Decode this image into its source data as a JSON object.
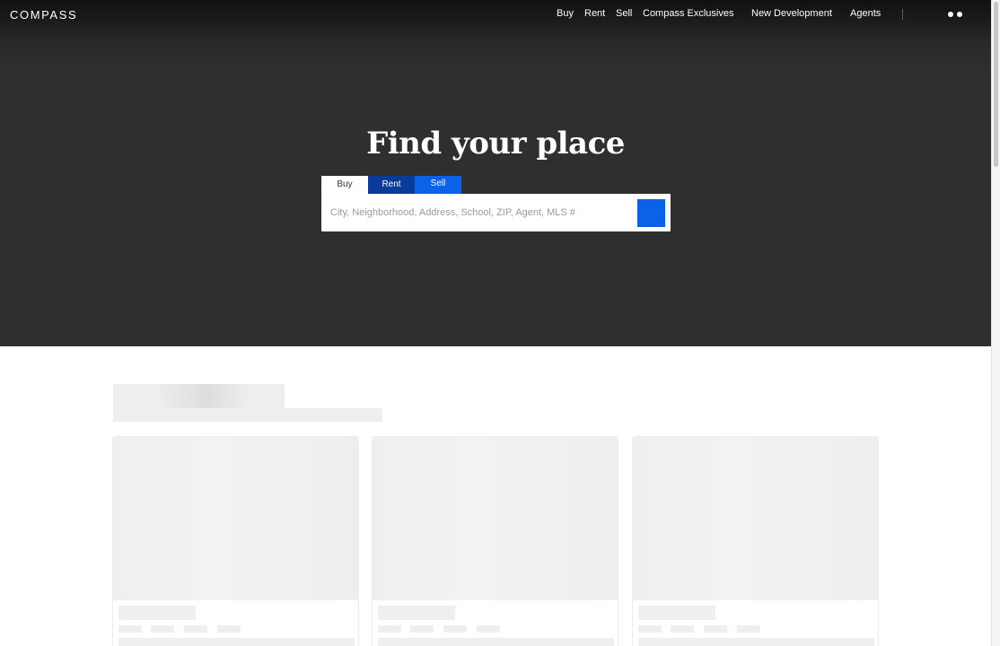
{
  "nav": {
    "logo": "COMPASS",
    "links": [
      "Buy",
      "Rent",
      "Sell",
      "Compass Exclusives",
      "New Development",
      "Agents"
    ],
    "menu_icon": "two-dots-menu-icon"
  },
  "hero": {
    "title": "Find your place",
    "tabs": [
      "Buy",
      "Rent",
      "Sell"
    ],
    "selected_tab": "Buy",
    "search_placeholder": "City, Neighborhood, Address, School, ZIP, Agent, MLS #",
    "search_value": ""
  },
  "colors": {
    "hero_background": "#2f2f2f",
    "accent_blue": "#0b62e6",
    "tab_rent_blue": "#0a3a9a",
    "skeleton_gray": "#efefef"
  },
  "listings": {
    "state": "loading",
    "placeholder_cards": 3
  }
}
